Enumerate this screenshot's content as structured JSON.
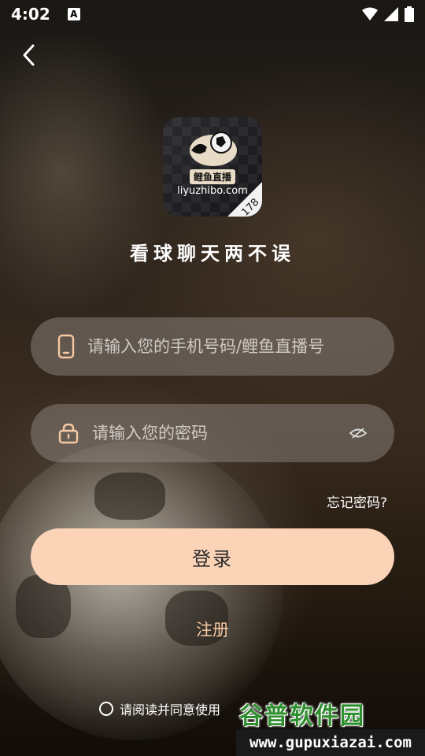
{
  "status_bar": {
    "time": "4:02",
    "icons": [
      "text-recognition-icon",
      "wifi-icon",
      "signal-icon",
      "battery-icon"
    ]
  },
  "logo": {
    "name_cn": "鲤鱼直播",
    "domain": "liyuzhibo.com",
    "badge_number": "178"
  },
  "slogan": "看球聊天两不误",
  "phone_field": {
    "placeholder": "请输入您的手机号码/鲤鱼直播号",
    "value": ""
  },
  "password_field": {
    "placeholder": "请输入您的密码",
    "value": ""
  },
  "forgot_password": "忘记密码?",
  "login_button": "登录",
  "register_link": "注册",
  "agreement": {
    "text": "请阅读并同意使用"
  },
  "watermark": {
    "title": "谷普软件园",
    "url": "www.gupuxiazai.com"
  },
  "colors": {
    "accent_button": "#fbd4b8",
    "register_text": "#f6c9a3",
    "field_bg": "rgba(150,145,140,0.45)"
  }
}
